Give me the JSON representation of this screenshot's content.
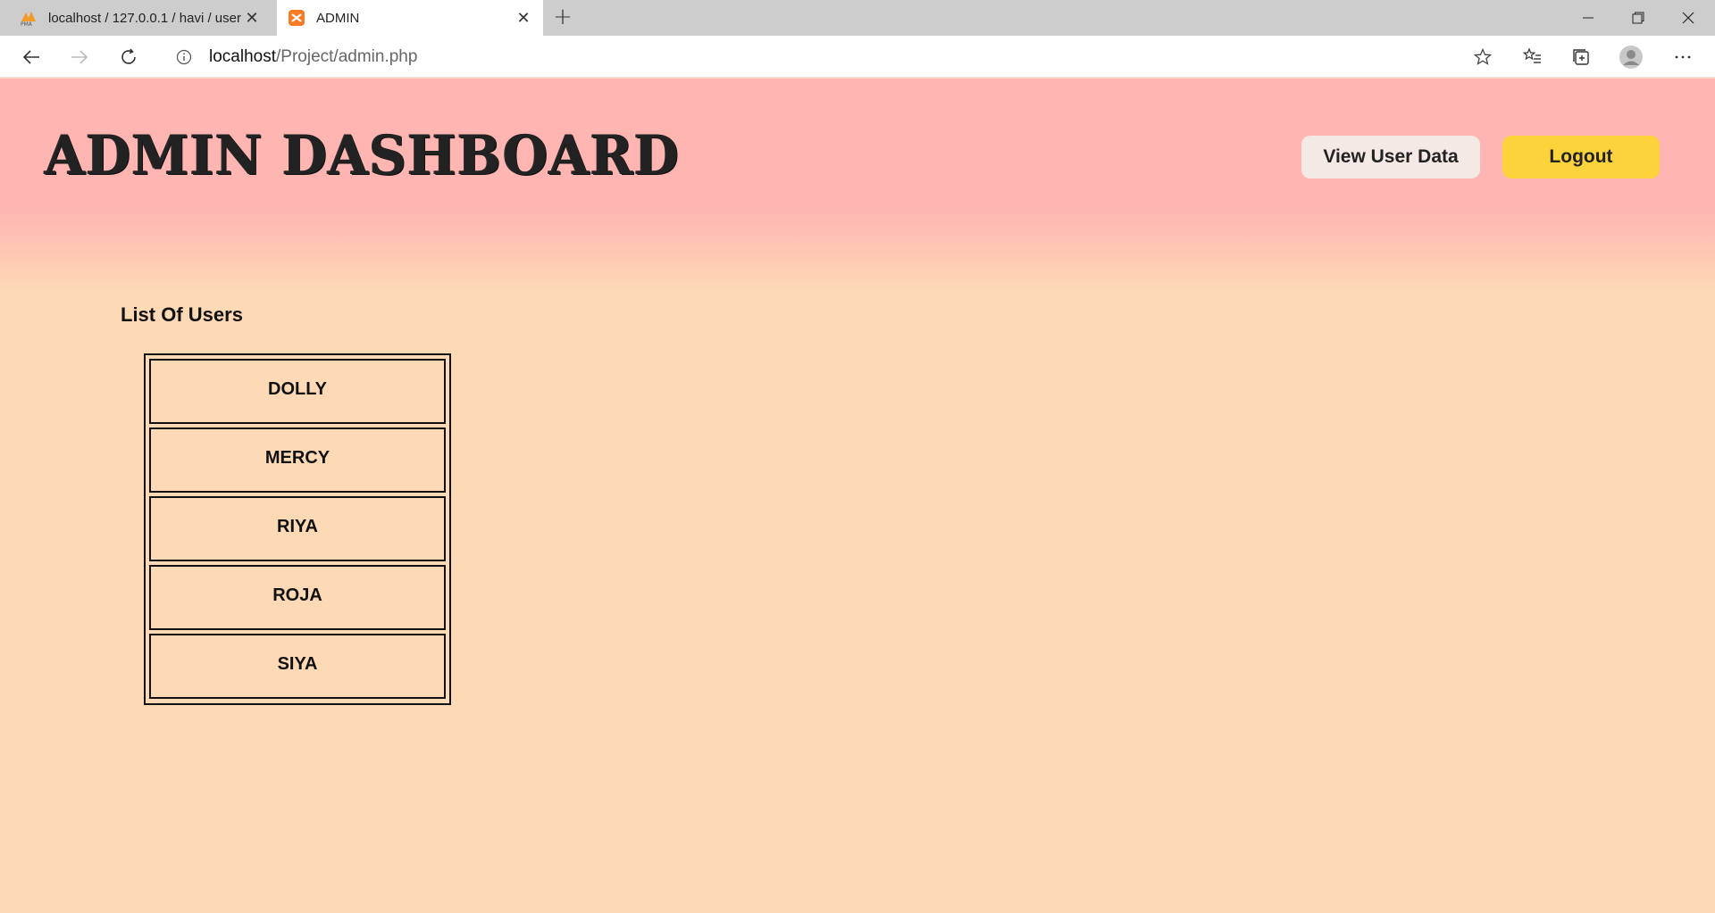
{
  "browser": {
    "tabs": [
      {
        "title": "localhost / 127.0.0.1 / havi / user",
        "favicon": "phpmyadmin-icon",
        "active": false
      },
      {
        "title": "ADMIN",
        "favicon": "xampp-icon",
        "active": true
      }
    ],
    "url_host": "localhost",
    "url_path": "/Project/admin.php"
  },
  "header": {
    "title": "ADMIN DASHBOARD",
    "view_user_data_label": "View User Data",
    "logout_label": "Logout"
  },
  "main": {
    "section_title": "List Of Users",
    "users": [
      "DOLLY",
      "MERCY",
      "RIYA",
      "ROJA",
      "SIYA"
    ]
  },
  "colors": {
    "header_bg": "#ffb6b2",
    "page_bg": "#fdd9b5",
    "logout_bg": "#fdd33c",
    "view_btn_bg": "#f4e9e4"
  }
}
